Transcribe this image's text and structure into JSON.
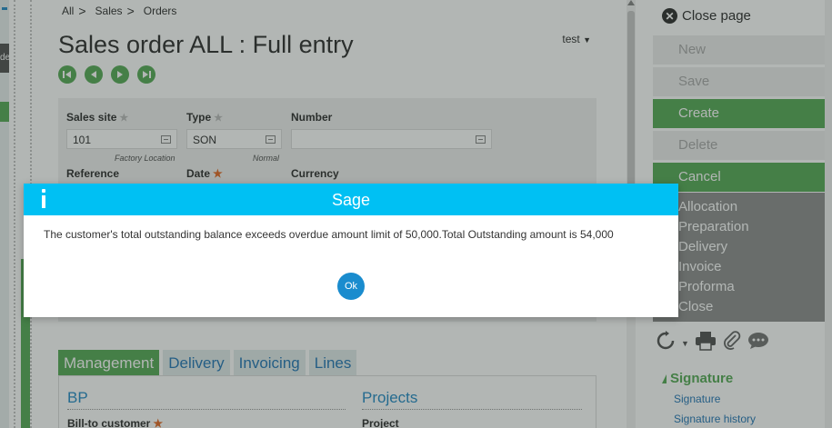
{
  "left_strip": {
    "fragment_text": "de"
  },
  "breadcrumb": [
    "All",
    "Sales",
    "Orders"
  ],
  "page": {
    "title": "Sales order ALL : Full entry",
    "user": "test"
  },
  "form": {
    "sales_site_label": "Sales site",
    "sales_site_value": "101",
    "sales_site_hint": "Factory Location",
    "type_label": "Type",
    "type_value": "SON",
    "type_hint": "Normal",
    "number_label": "Number",
    "number_value": "",
    "reference_label": "Reference",
    "date_label": "Date",
    "currency_label": "Currency"
  },
  "tabs": [
    "Management",
    "Delivery",
    "Invoicing",
    "Lines"
  ],
  "sections": {
    "bp_title": "BP",
    "projects_title": "Projects",
    "bill_to_label": "Bill-to customer",
    "project_label": "Project"
  },
  "right_panel": {
    "close_label": "Close page",
    "actions": [
      {
        "label": "New",
        "enabled": false
      },
      {
        "label": "Save",
        "enabled": false
      },
      {
        "label": "Create",
        "enabled": true
      },
      {
        "label": "Delete",
        "enabled": false
      },
      {
        "label": "Cancel",
        "enabled": true
      }
    ],
    "menu": [
      "Allocation",
      "Preparation",
      "Delivery",
      "Invoice",
      "Proforma",
      "Close"
    ],
    "signature": {
      "title": "Signature",
      "links": [
        "Signature",
        "Signature history"
      ]
    }
  },
  "dialog": {
    "title": "Sage",
    "message": "The customer's total outstanding balance exceeds overdue amount limit of 50,000.Total Outstanding amount is 54,000",
    "ok_label": "Ok"
  },
  "colors": {
    "accent_green": "#5aac5a",
    "dialog_header": "#00c0f3",
    "ok_button": "#1a8cce",
    "link_blue": "#2a7ab8"
  }
}
